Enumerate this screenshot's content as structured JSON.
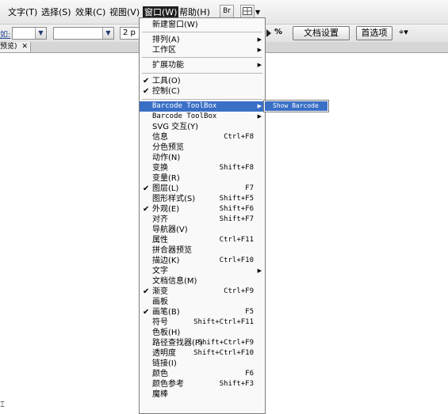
{
  "menubar": {
    "items": [
      {
        "label": "文字(T)"
      },
      {
        "label": "选择(S)"
      },
      {
        "label": "效果(C)"
      },
      {
        "label": "视图(V)"
      },
      {
        "label": "窗口(W)"
      },
      {
        "label": "帮助(H)"
      }
    ],
    "br_button": "Br"
  },
  "controlbar": {
    "label_fragment": "如:",
    "stroke_value": "2 p",
    "percent_symbol": "%",
    "doc_setup_button": "文档设置",
    "preferences_button": "首选项"
  },
  "tab": {
    "label": "预览)"
  },
  "menu": {
    "items": [
      {
        "label": "新建窗口(W)",
        "shortcut": "",
        "checked": false,
        "submenu": false
      },
      {
        "label": "排列(A)",
        "shortcut": "",
        "checked": false,
        "submenu": true
      },
      {
        "label": "工作区",
        "shortcut": "",
        "checked": false,
        "submenu": true
      },
      {
        "label": "扩展功能",
        "shortcut": "",
        "checked": false,
        "submenu": true
      },
      {
        "label": "工具(O)",
        "shortcut": "",
        "checked": true,
        "submenu": false
      },
      {
        "label": "控制(C)",
        "shortcut": "",
        "checked": true,
        "submenu": false
      },
      {
        "label": "Barcode ToolBox",
        "shortcut": "",
        "checked": false,
        "submenu": true,
        "highlighted": true
      },
      {
        "label": "Barcode ToolBox",
        "shortcut": "",
        "checked": false,
        "submenu": true
      },
      {
        "label": "SVG 交互(Y)",
        "shortcut": "",
        "checked": false,
        "submenu": false
      },
      {
        "label": "信息",
        "shortcut": "Ctrl+F8",
        "checked": false,
        "submenu": false
      },
      {
        "label": "分色预览",
        "shortcut": "",
        "checked": false,
        "submenu": false
      },
      {
        "label": "动作(N)",
        "shortcut": "",
        "checked": false,
        "submenu": false
      },
      {
        "label": "变换",
        "shortcut": "Shift+F8",
        "checked": false,
        "submenu": false
      },
      {
        "label": "变量(R)",
        "shortcut": "",
        "checked": false,
        "submenu": false
      },
      {
        "label": "图层(L)",
        "shortcut": "F7",
        "checked": true,
        "submenu": false
      },
      {
        "label": "图形样式(S)",
        "shortcut": "Shift+F5",
        "checked": false,
        "submenu": false
      },
      {
        "label": "外观(E)",
        "shortcut": "Shift+F6",
        "checked": true,
        "submenu": false
      },
      {
        "label": "对齐",
        "shortcut": "Shift+F7",
        "checked": false,
        "submenu": false
      },
      {
        "label": "导航器(V)",
        "shortcut": "",
        "checked": false,
        "submenu": false
      },
      {
        "label": "属性",
        "shortcut": "Ctrl+F11",
        "checked": false,
        "submenu": false
      },
      {
        "label": "拼合器预览",
        "shortcut": "",
        "checked": false,
        "submenu": false
      },
      {
        "label": "描边(K)",
        "shortcut": "Ctrl+F10",
        "checked": false,
        "submenu": false
      },
      {
        "label": "文字",
        "shortcut": "",
        "checked": false,
        "submenu": true
      },
      {
        "label": "文档信息(M)",
        "shortcut": "",
        "checked": false,
        "submenu": false
      },
      {
        "label": "渐变",
        "shortcut": "Ctrl+F9",
        "checked": true,
        "submenu": false
      },
      {
        "label": "画板",
        "shortcut": "",
        "checked": false,
        "submenu": false
      },
      {
        "label": "画笔(B)",
        "shortcut": "F5",
        "checked": true,
        "submenu": false
      },
      {
        "label": "符号",
        "shortcut": "Shift+Ctrl+F11",
        "checked": false,
        "submenu": false
      },
      {
        "label": "色板(H)",
        "shortcut": "",
        "checked": false,
        "submenu": false
      },
      {
        "label": "路径查找器(P)",
        "shortcut": "Shift+Ctrl+F9",
        "checked": false,
        "submenu": false
      },
      {
        "label": "透明度",
        "shortcut": "Shift+Ctrl+F10",
        "checked": false,
        "submenu": false
      },
      {
        "label": "链接(I)",
        "shortcut": "",
        "checked": false,
        "submenu": false
      },
      {
        "label": "颜色",
        "shortcut": "F6",
        "checked": false,
        "submenu": false
      },
      {
        "label": "颜色参考",
        "shortcut": "Shift+F3",
        "checked": false,
        "submenu": false
      },
      {
        "label": "魔棒",
        "shortcut": "",
        "checked": false,
        "submenu": false
      }
    ]
  },
  "submenu": {
    "item": "Show Barcode"
  },
  "colors": {
    "highlight": "#3a6fc6",
    "menubar_open": "#1f1f1f"
  }
}
